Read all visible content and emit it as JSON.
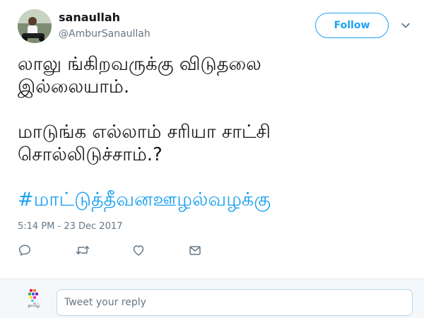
{
  "author": {
    "display_name": "sanaullah",
    "handle": "@AmburSanaullah",
    "avatar_icon": "profile-photo"
  },
  "follow_button": {
    "label": "Follow",
    "color": "#1da1f2"
  },
  "menu_icon": "chevron-down-icon",
  "tweet": {
    "lines": [
      "லாலு ங்கிறவருக்கு விடுதலை",
      "இல்லையாம்.",
      "மாடுங்க எல்லாம்  சரியா சாட்சி",
      "சொல்லிடுச்சாம்.?"
    ],
    "hashtag": "#மாட்டுத்தீவனஊழல்வழக்கு",
    "timestamp": "5:14 PM - 23 Dec 2017"
  },
  "actions": [
    {
      "name": "reply-icon"
    },
    {
      "name": "retweet-icon"
    },
    {
      "name": "like-icon"
    },
    {
      "name": "direct-message-icon"
    }
  ],
  "reply": {
    "placeholder": "Tweet your reply",
    "avatar_icon": "tamil-logo-icon",
    "avatar_caption": "தமிழ்"
  },
  "colors": {
    "accent": "#1da1f2",
    "text_primary": "#14171a",
    "text_secondary": "#657786",
    "reply_bar_bg": "#f5f8fa"
  }
}
